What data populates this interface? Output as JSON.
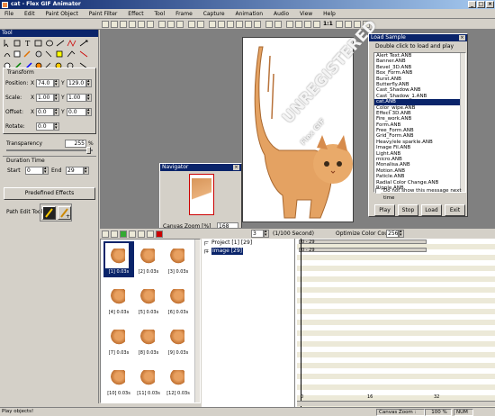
{
  "window": {
    "title": "cat - Flex GIF Animator",
    "min": "_",
    "max": "□",
    "close": "×"
  },
  "menu": [
    "File",
    "Edit",
    "Paint Object",
    "Paint Filter",
    "Effect",
    "Tool",
    "Frame",
    "Capture",
    "Animation",
    "Audio",
    "View",
    "Help"
  ],
  "toolbar": {
    "zoom_ratio": "1:1"
  },
  "tool_panel": {
    "header": "Tool",
    "transform": {
      "section": "Transform",
      "position_label": "Position:",
      "x_label": "X",
      "y_label": "Y",
      "position_x": "74.0",
      "position_y": "129.0",
      "scale_label": "Scale:",
      "scale_x": "1.00",
      "scale_y": "1.00",
      "offset_label": "Offset:",
      "offset_x": "0.0",
      "offset_y": "0.0",
      "rotate_label": "Rotate:",
      "rotate": "0.0"
    },
    "transparency": {
      "label": "Transparency",
      "value": "255",
      "unit": "%"
    },
    "duration": {
      "section": "Duration Time",
      "start_label": "Start",
      "start": "0",
      "end_label": "End",
      "end": "29"
    },
    "predefined_button": "Predefined Effects",
    "path_edit_label": "Path Edit Tool"
  },
  "canvas": {
    "watermark": "UNREGISTERED",
    "watermark_sub": "Flex GIF"
  },
  "navigator": {
    "header": "Navigator",
    "zoom_label": "Canvas Zoom [%]",
    "zoom_value": "168"
  },
  "load_sample": {
    "header": "Load Sample",
    "instruction": "Double click to load and play",
    "items": [
      "Alert Text.ANB",
      "Banner.ANB",
      "Bevel_3D.ANB",
      "Box_Form.ANB",
      "Burst.ANB",
      "Butterfly.ANB",
      "Cast_Shadow.ANB",
      "Cast_Shadow_1.ANB",
      "cat.ANB",
      "Color_wipe.ANB",
      "Effect 3D.ANB",
      "Fire_work.ANB",
      "Form.ANB",
      "Free_Form.ANB",
      "Grid_Form.ANB",
      "Heavy/ele sparkle.ANB",
      "Image Fil.ANB",
      "Light.ANB",
      "micro.ANB",
      "Monalisa.ANB",
      "Motion.ANB",
      "Paticle.ANB",
      "Radial Color Change.ANB",
      "Ripple.ANB"
    ],
    "selected_index": 8,
    "checkbox_label": "Do not show this message next time",
    "buttons": {
      "play": "Play",
      "stop": "Stop",
      "load": "Load",
      "exit": "Exit"
    }
  },
  "timeline": {
    "speed_value": "3",
    "speed_unit": "(1/100 Second)",
    "optimize_label": "Optimize Color Count",
    "optimize_value": "256",
    "tree": {
      "project": "Project [1] [29]",
      "image": "Image [29]"
    },
    "bars": [
      "0 - 29",
      "0 - 29"
    ],
    "ruler": [
      "0",
      "16",
      "32"
    ]
  },
  "frames": [
    "[1] 0.03s",
    "[2] 0.03s",
    "[3] 0.03s",
    "[4] 0.03s",
    "[5] 0.03s",
    "[6] 0.03s",
    "[7] 0.03s",
    "[8] 0.03s",
    "[9] 0.03s",
    "[10] 0.03s",
    "[11] 0.03s",
    "[12] 0.03s"
  ],
  "status": {
    "message": "Play objects!",
    "zoom_label": "Canvas Zoom :",
    "zoom_value": "100 %",
    "num": "NUM"
  }
}
